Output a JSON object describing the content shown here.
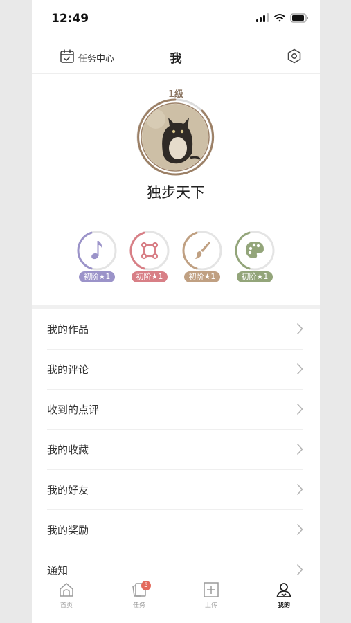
{
  "status_bar": {
    "time": "12:49"
  },
  "header": {
    "task_center_label": "任务中心",
    "title": "我"
  },
  "profile": {
    "level": "1级",
    "nickname": "独步天下",
    "badges": [
      {
        "name": "music",
        "label": "初阶★1",
        "color": "#9b93c9"
      },
      {
        "name": "design",
        "label": "初阶★1",
        "color": "#d87f86"
      },
      {
        "name": "painting",
        "label": "初阶★1",
        "color": "#c0a082"
      },
      {
        "name": "palette",
        "label": "初阶★1",
        "color": "#93a57a"
      }
    ]
  },
  "menu": [
    "我的作品",
    "我的评论",
    "收到的点评",
    "我的收藏",
    "我的好友",
    "我的奖励",
    "通知"
  ],
  "tabbar": {
    "items": [
      {
        "label": "首页"
      },
      {
        "label": "任务",
        "badge": "5"
      },
      {
        "label": "上传"
      },
      {
        "label": "我的"
      }
    ]
  },
  "colors": {
    "ring": "#9c8066",
    "accent_badge": "#e36a5c"
  }
}
